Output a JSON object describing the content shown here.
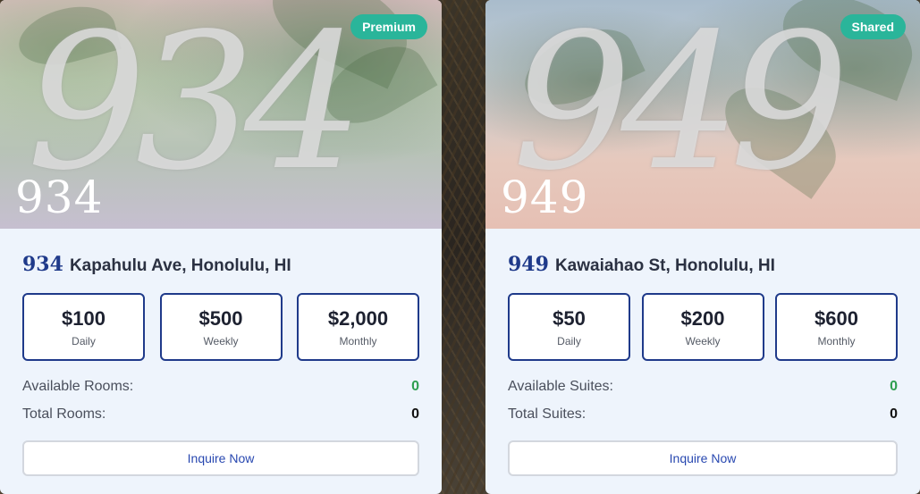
{
  "listings": [
    {
      "badge": "Premium",
      "hero_watermark": "934",
      "hero_number": "934",
      "address_number": "934",
      "address_street": "Kapahulu Ave, Honolulu, HI",
      "prices": [
        {
          "amount": "$100",
          "period": "Daily"
        },
        {
          "amount": "$500",
          "period": "Weekly"
        },
        {
          "amount": "$2,000",
          "period": "Monthly"
        }
      ],
      "available_label": "Available Rooms:",
      "available_value": "0",
      "total_label": "Total Rooms:",
      "total_value": "0",
      "button_label": "Inquire Now"
    },
    {
      "badge": "Shared",
      "hero_watermark": "949",
      "hero_number": "949",
      "address_number": "949",
      "address_street": "Kawaiahao St, Honolulu, HI",
      "prices": [
        {
          "amount": "$50",
          "period": "Daily"
        },
        {
          "amount": "$200",
          "period": "Weekly"
        },
        {
          "amount": "$600",
          "period": "Monthly"
        }
      ],
      "available_label": "Available Suites:",
      "available_value": "0",
      "total_label": "Total Suites:",
      "total_value": "0",
      "button_label": "Inquire Now"
    }
  ],
  "colors": {
    "badge": "#2ab59a",
    "accent": "#1f3a8a",
    "available": "#2e9e4f",
    "link": "#2848b0"
  }
}
